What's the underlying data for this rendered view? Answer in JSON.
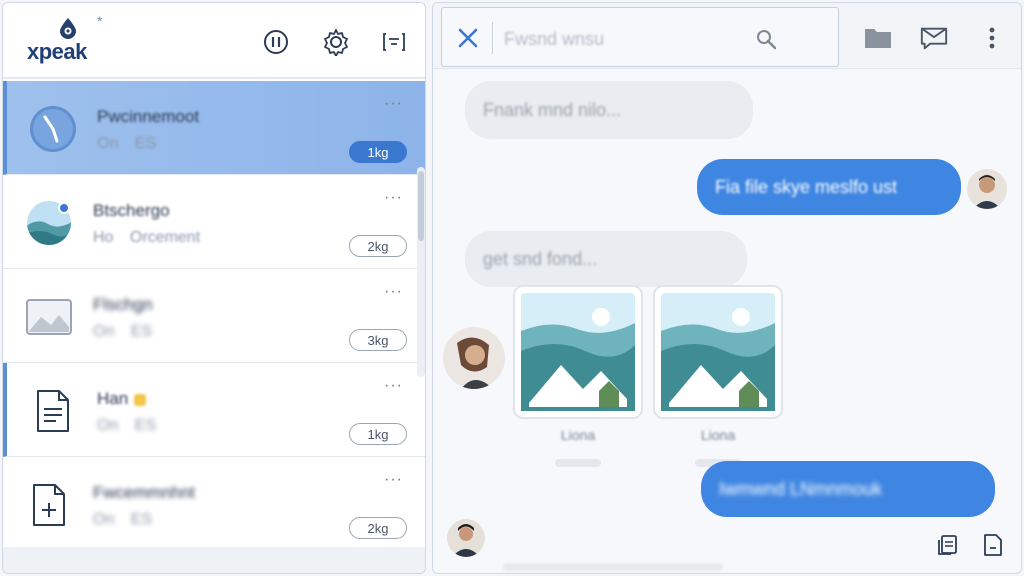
{
  "brand": {
    "name": "xpeak",
    "accent": "#3a78d0",
    "star": "*"
  },
  "conversations": [
    {
      "title": "Pwcinnemoot",
      "sub": "On  ES",
      "badge": "1kg",
      "menu": "···",
      "thumb": "clock-avatar",
      "active": true
    },
    {
      "title": "Btschergo",
      "sub": "Ho  Orcement",
      "badge": "2kg",
      "menu": "···",
      "thumb": "landscape-avatar",
      "active": false
    },
    {
      "title": "Flschgn",
      "sub": "On  ES",
      "badge": "3kg",
      "menu": "···",
      "thumb": "image-icon",
      "active": false
    },
    {
      "title": "Han",
      "sub": "On  ES",
      "badge": "1kg",
      "menu": "···",
      "thumb": "document-icon",
      "active": false
    },
    {
      "title": "Fwcemmnhnt",
      "sub": "On  ES",
      "badge": "2kg",
      "menu": "···",
      "thumb": "file-add-icon",
      "active": false
    }
  ],
  "search": {
    "value": "Fwsnd wnsu"
  },
  "messages": [
    {
      "dir": "in",
      "text": "Fnank mnd nilo..."
    },
    {
      "dir": "out",
      "text": "Fia file skye meslfo ust"
    },
    {
      "dir": "in",
      "text": "get snd fond..."
    },
    {
      "dir": "out",
      "text": "Iwmwnd LNmnmouk"
    }
  ],
  "attachments": [
    {
      "label": "Liona"
    },
    {
      "label": "Liona"
    }
  ]
}
